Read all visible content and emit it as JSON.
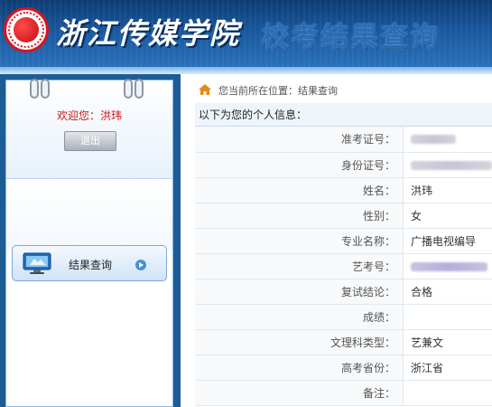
{
  "header": {
    "school_name": "浙江传媒学院",
    "site_title": "校考结果查询",
    "logo_icon": "school-emblem-icon"
  },
  "sidebar": {
    "welcome_label": "欢迎您：",
    "user_name": "洪玮",
    "logout_label": "退出",
    "nav_result_label": "结果查询",
    "nav_icon": "monitor-icon"
  },
  "breadcrumb": {
    "icon": "home-icon",
    "text": "您当前所在位置：结果查询"
  },
  "info": {
    "title": "以下为您的个人信息：",
    "rows": [
      {
        "label": "准考证号：",
        "value": ""
      },
      {
        "label": "身份证号：",
        "value": ""
      },
      {
        "label": "姓名：",
        "value": "洪玮"
      },
      {
        "label": "性别：",
        "value": "女"
      },
      {
        "label": "专业名称：",
        "value": "广播电视编导"
      },
      {
        "label": "艺考号：",
        "value": ""
      },
      {
        "label": "复试结论：",
        "value": "合格"
      },
      {
        "label": "成绩：",
        "value": ""
      },
      {
        "label": "文理科类型：",
        "value": "艺兼文"
      },
      {
        "label": "高考省份：",
        "value": "浙江省"
      },
      {
        "label": "备注：",
        "value": ""
      }
    ]
  },
  "colors": {
    "header_dark": "#0d3c74",
    "sidebar_bg": "#1d5d96",
    "welcome_red": "#d21414"
  }
}
